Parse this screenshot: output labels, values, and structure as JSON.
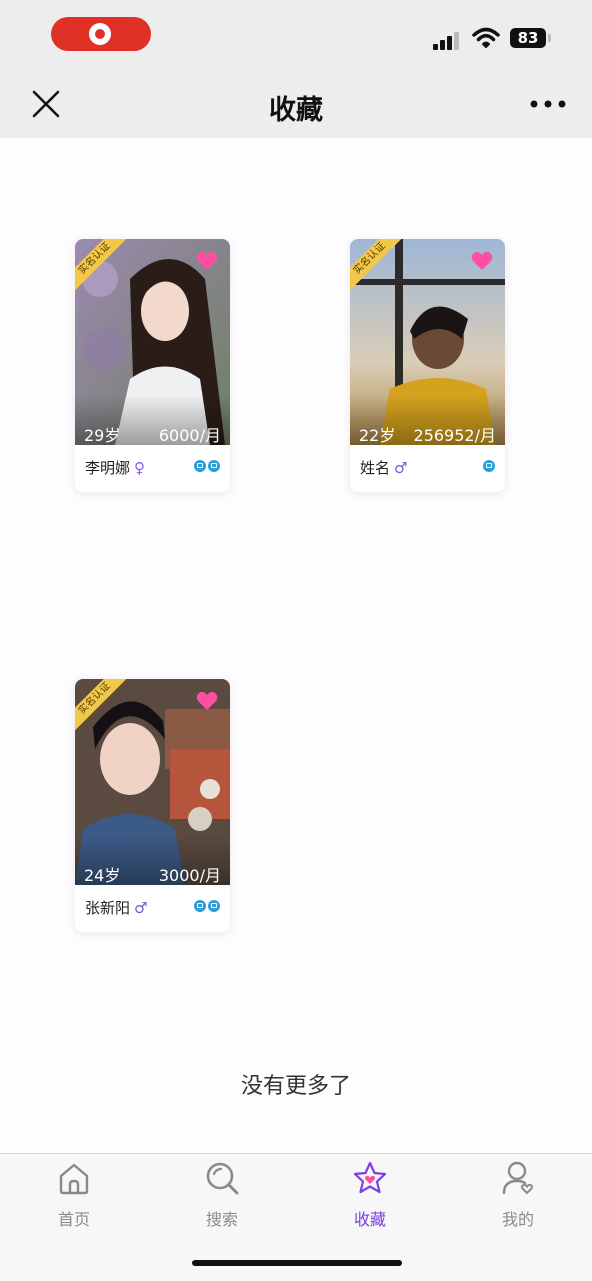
{
  "status_bar": {
    "battery": "83"
  },
  "nav": {
    "title": "收藏"
  },
  "cards": [
    {
      "name": "李明娜",
      "gender": "♀",
      "gender_color": "#8b5cf6",
      "age": "29岁",
      "salary": "6000/月",
      "verify": "实名认证"
    },
    {
      "name": "姓名",
      "gender": "♂",
      "gender_color": "#6d5bd0",
      "age": "22岁",
      "salary": "256952/月",
      "verify": "实名认证"
    },
    {
      "name": "张新阳",
      "gender": "♂",
      "gender_color": "#6d5bd0",
      "age": "24岁",
      "salary": "3000/月",
      "verify": "实名认证"
    }
  ],
  "footer_note": "没有更多了",
  "tabs": [
    {
      "label": "首页",
      "icon": "home-icon"
    },
    {
      "label": "搜索",
      "icon": "search-icon"
    },
    {
      "label": "收藏",
      "icon": "star-icon",
      "active": true
    },
    {
      "label": "我的",
      "icon": "profile-icon"
    }
  ],
  "colors": {
    "accent": "#7b3fe4",
    "heart": "#ff4fa3",
    "rec": "#e03126"
  }
}
